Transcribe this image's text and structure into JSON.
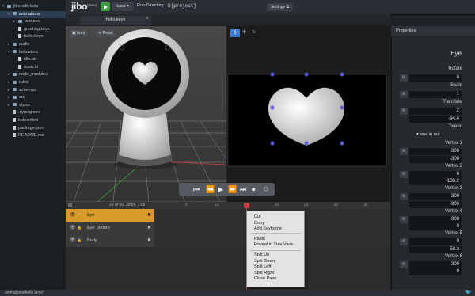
{
  "app": {
    "logo": "jibo",
    "beta": "(Beta)",
    "env": "local",
    "run_directory": "Run Directory",
    "project": "${project}",
    "settings": "Settings"
  },
  "tree": [
    {
      "label": "jibo-sdk-beta",
      "depth": 0,
      "kind": "folder",
      "open": true,
      "selected": false
    },
    {
      "label": "animations",
      "depth": 1,
      "kind": "folder",
      "open": true,
      "selected": true
    },
    {
      "label": "textures",
      "depth": 2,
      "kind": "folder",
      "open": false,
      "selected": false
    },
    {
      "label": "greeting.keys",
      "depth": 2,
      "kind": "file",
      "selected": false
    },
    {
      "label": "hello.keys",
      "depth": 2,
      "kind": "file",
      "selected": false
    },
    {
      "label": "audio",
      "depth": 1,
      "kind": "folder",
      "open": false,
      "selected": false
    },
    {
      "label": "behaviors",
      "depth": 1,
      "kind": "folder",
      "open": true,
      "selected": false
    },
    {
      "label": "idle.bt",
      "depth": 2,
      "kind": "file",
      "selected": false
    },
    {
      "label": "main.bt",
      "depth": 2,
      "kind": "file",
      "selected": false
    },
    {
      "label": "node_modules",
      "depth": 1,
      "kind": "folder",
      "open": false,
      "selected": false
    },
    {
      "label": "rules",
      "depth": 1,
      "kind": "folder",
      "open": false,
      "selected": false
    },
    {
      "label": "schemas",
      "depth": 1,
      "kind": "folder",
      "open": false,
      "selected": false
    },
    {
      "label": "src",
      "depth": 1,
      "kind": "folder",
      "open": false,
      "selected": false
    },
    {
      "label": "styles",
      "depth": 1,
      "kind": "folder",
      "open": false,
      "selected": false
    },
    {
      "label": ".syncignore",
      "depth": 1,
      "kind": "file",
      "selected": false
    },
    {
      "label": "index.html",
      "depth": 1,
      "kind": "file",
      "selected": false
    },
    {
      "label": "package.json",
      "depth": 1,
      "kind": "file",
      "selected": false
    },
    {
      "label": "README.md",
      "depth": 1,
      "kind": "file",
      "selected": false
    }
  ],
  "tab": {
    "label": "hello.keys",
    "close": "×"
  },
  "viewport": {
    "front": "front",
    "reset": "Reset"
  },
  "timeline": {
    "frame_info": "20 of 60, 30fps, 2.0s",
    "ruler": [
      "5",
      "10",
      "15",
      "20",
      "25",
      "30",
      "35",
      "40"
    ],
    "tracks": [
      {
        "label": "Eye",
        "selected": true
      },
      {
        "label": "Eye Texture",
        "selected": false
      },
      {
        "label": "Body",
        "selected": false
      }
    ]
  },
  "context_menu": {
    "group1": [
      "Cut",
      "Copy",
      "Add Keyframe"
    ],
    "group2": [
      "Paste",
      "Reveal in Tree View"
    ],
    "group3": [
      "Split Up",
      "Split Down",
      "Split Left",
      "Split Right",
      "Close Pane"
    ]
  },
  "properties": {
    "panel_title": "Properties",
    "object": "Eye",
    "rotate": {
      "label": "Rotate",
      "values": [
        "0"
      ]
    },
    "scale": {
      "label": "Scale",
      "values": [
        "1"
      ]
    },
    "translate": {
      "label": "Translate",
      "values": [
        "2",
        "-94.4"
      ]
    },
    "tween": {
      "label": "Tween",
      "value": "sine in out"
    },
    "vertices": [
      {
        "label": "Vertex 1",
        "values": [
          "-300",
          "-300"
        ]
      },
      {
        "label": "Vertex 2",
        "values": [
          "0",
          "-130.2"
        ]
      },
      {
        "label": "Vertex 3",
        "values": [
          "300",
          "-300"
        ]
      },
      {
        "label": "Vertex 4",
        "values": [
          "-300",
          "0"
        ]
      },
      {
        "label": "Vertex 5",
        "values": [
          "0",
          "50.3"
        ]
      },
      {
        "label": "Vertex 6",
        "values": [
          "300",
          "0"
        ]
      }
    ]
  },
  "status": "animations/hello.keys*",
  "colors": {
    "accent": "#3d7fd6",
    "timeline_selected": "#d89b2a",
    "play": "#3f9a3f",
    "playhead": "#d23b3b"
  }
}
